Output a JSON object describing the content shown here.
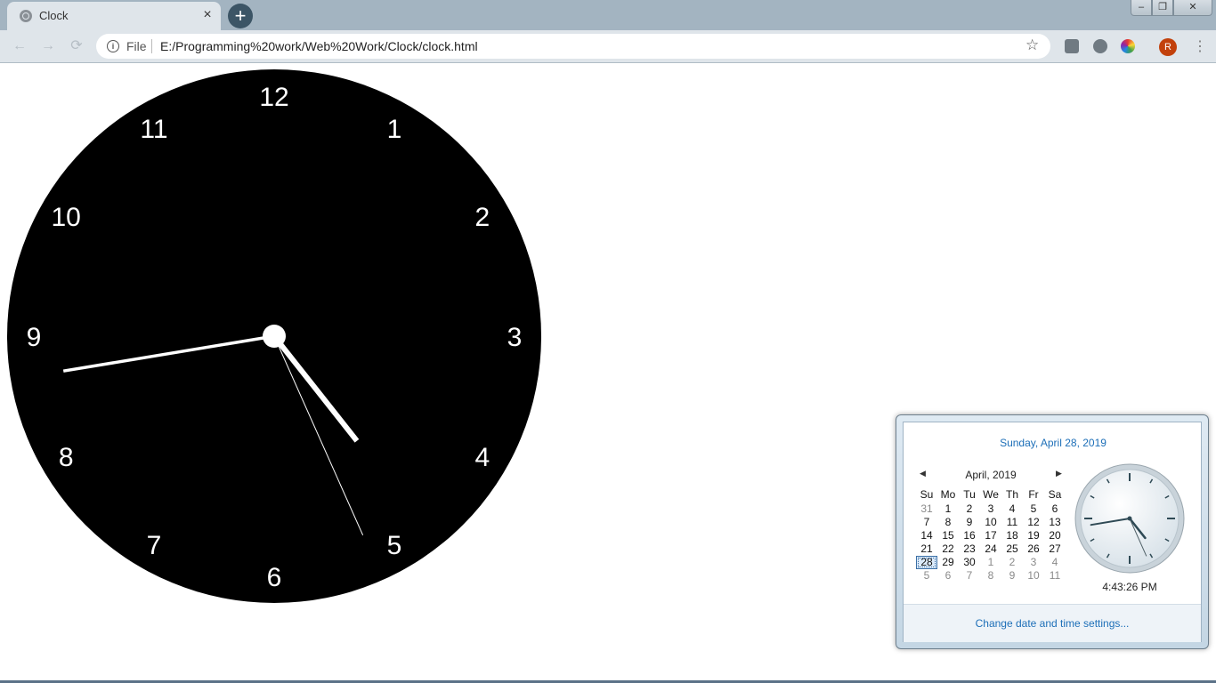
{
  "browser": {
    "tab_title": "Clock",
    "tab_close": "×",
    "new_tab": "+",
    "window_buttons": {
      "minimize": "‒",
      "maximize": "❐",
      "close": "✕"
    },
    "nav": {
      "back": "←",
      "forward": "→",
      "reload": "⟳"
    },
    "address": {
      "info_icon": "i",
      "scheme_label": "File",
      "url": "E:/Programming%20work/Web%20Work/Clock/clock.html"
    },
    "bookmark_icon": "☆",
    "avatar_letter": "R",
    "menu_icon": "⋮",
    "extensions": [
      "cube-icon",
      "gear-icon",
      "color-picker-icon"
    ]
  },
  "clock": {
    "face_color": "#000000",
    "hand_color": "#ffffff",
    "numerals": [
      "12",
      "1",
      "2",
      "3",
      "4",
      "5",
      "6",
      "7",
      "8",
      "9",
      "10",
      "11"
    ],
    "time_shown": {
      "hour": 4,
      "minute": 43,
      "second": 26
    }
  },
  "tray_popup": {
    "date_title": "Sunday, April 28, 2019",
    "month_label": "April, 2019",
    "weekdays": [
      "Su",
      "Mo",
      "Tu",
      "We",
      "Th",
      "Fr",
      "Sa"
    ],
    "weeks": [
      [
        "31",
        "1",
        "2",
        "3",
        "4",
        "5",
        "6"
      ],
      [
        "7",
        "8",
        "9",
        "10",
        "11",
        "12",
        "13"
      ],
      [
        "14",
        "15",
        "16",
        "17",
        "18",
        "19",
        "20"
      ],
      [
        "21",
        "22",
        "23",
        "24",
        "25",
        "26",
        "27"
      ],
      [
        "28",
        "29",
        "30",
        "1",
        "2",
        "3",
        "4"
      ],
      [
        "5",
        "6",
        "7",
        "8",
        "9",
        "10",
        "11"
      ]
    ],
    "selected_day": "28",
    "time_label": "4:43:26 PM",
    "settings_link": "Change date and time settings...",
    "prev_icon": "◀",
    "next_icon": "▶"
  }
}
